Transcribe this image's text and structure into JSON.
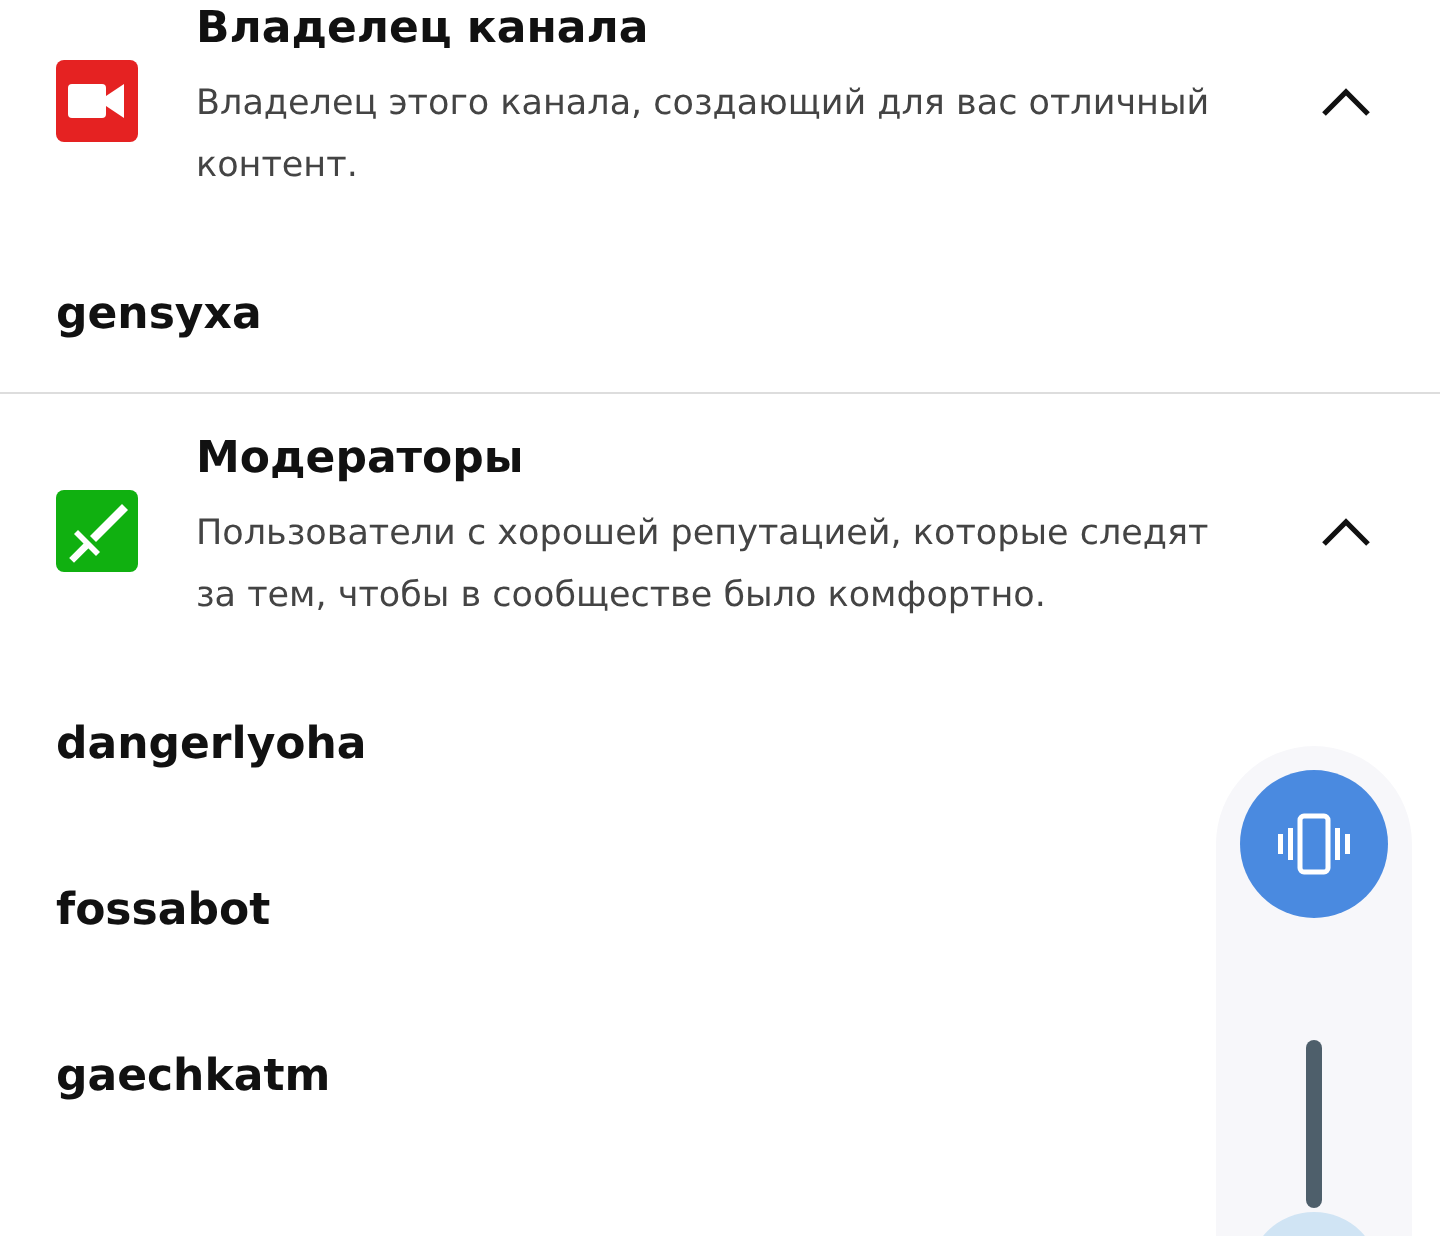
{
  "sections": [
    {
      "kind": "camera",
      "color": "#e52222",
      "title": "Владелец канала",
      "description": "Владелец этого канала, создающий для вас отличный контент.",
      "expanded": true,
      "members": [
        "gensyxa"
      ]
    },
    {
      "kind": "sword",
      "color": "#10b010",
      "title": "Модераторы",
      "description": "Пользователи с хорошей репутацией, которые следят за тем, чтобы в сообществе было комфортно.",
      "expanded": true,
      "members": [
        "dangerlyoha",
        "fossabot",
        "gaechkatm"
      ]
    }
  ],
  "volume_panel": {
    "vibrate_selected": true
  }
}
